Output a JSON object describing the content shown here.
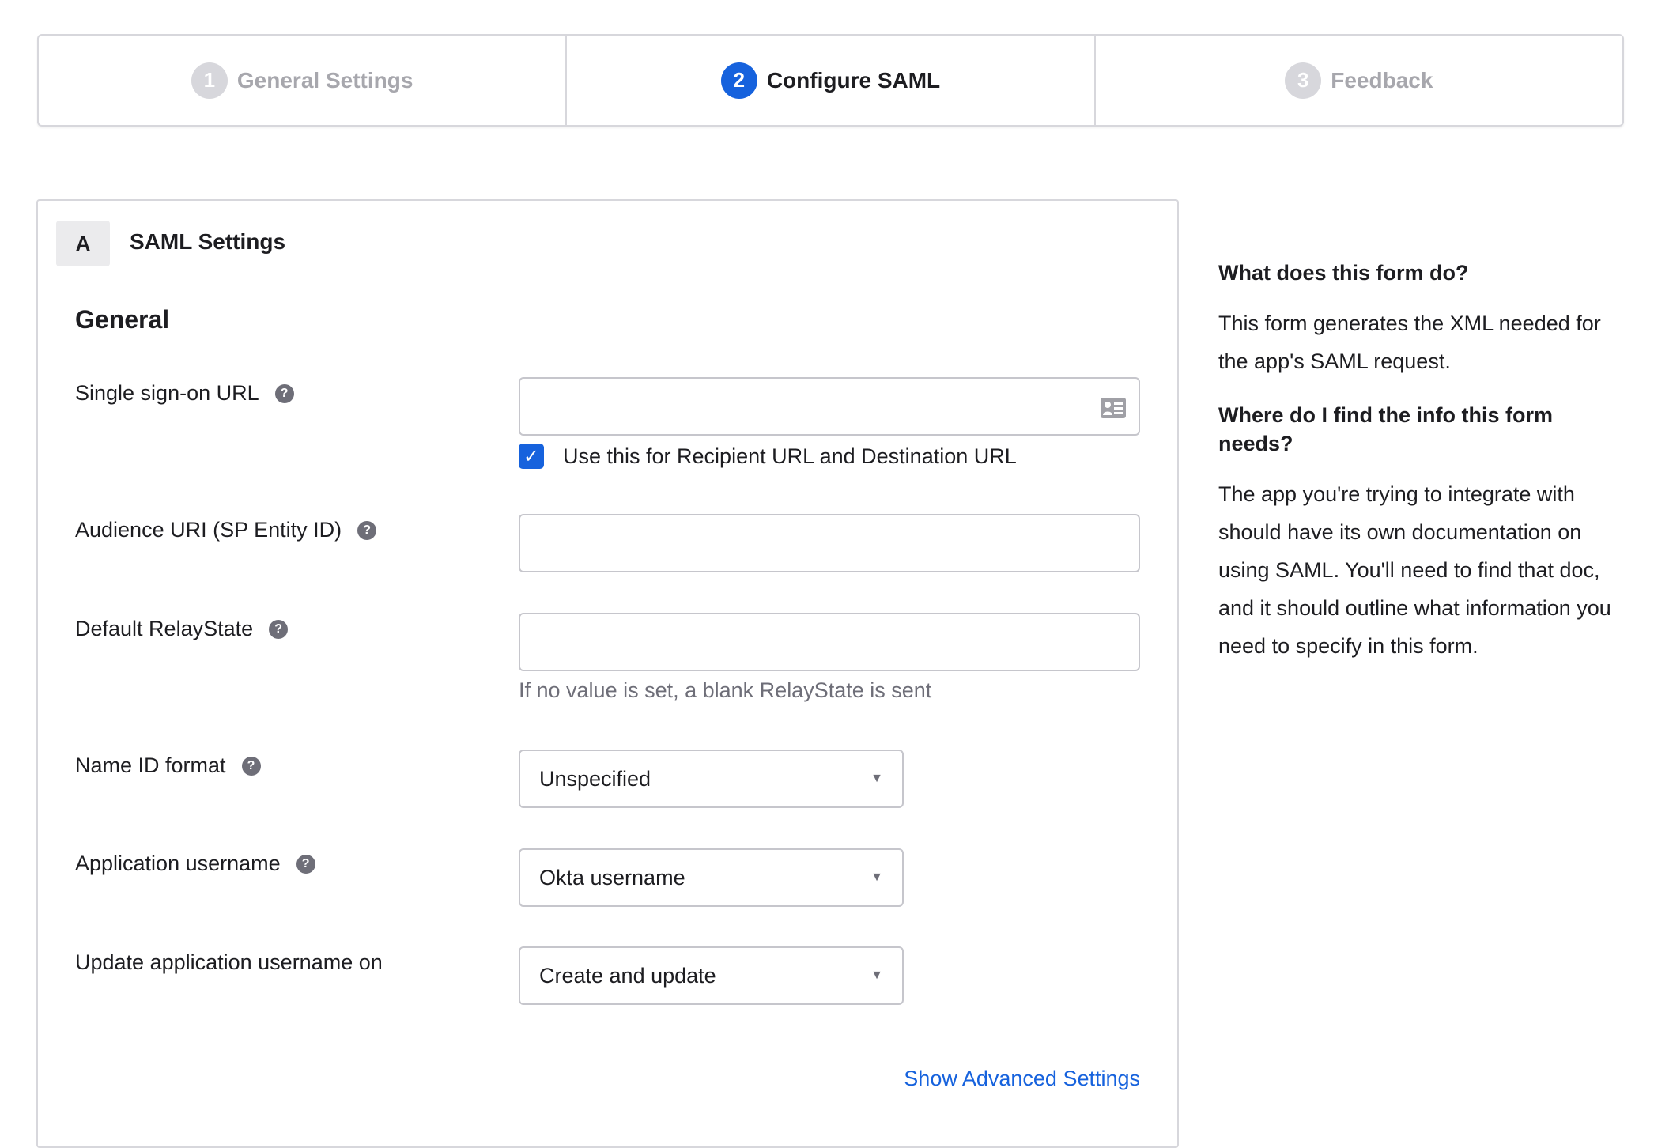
{
  "steps": [
    {
      "num": "1",
      "label": "General Settings",
      "active": false
    },
    {
      "num": "2",
      "label": "Configure SAML",
      "active": true
    },
    {
      "num": "3",
      "label": "Feedback",
      "active": false
    }
  ],
  "section": {
    "letter": "A",
    "title": "SAML Settings",
    "subtitle": "General"
  },
  "fields": {
    "sso_url": {
      "label": "Single sign-on URL",
      "value": "",
      "checkbox_label": "Use this for Recipient URL and Destination URL",
      "checked": true
    },
    "audience": {
      "label": "Audience URI (SP Entity ID)",
      "value": ""
    },
    "relay": {
      "label": "Default RelayState",
      "value": "",
      "hint": "If no value is set, a blank RelayState is sent"
    },
    "name_id": {
      "label": "Name ID format",
      "value": "Unspecified"
    },
    "app_username": {
      "label": "Application username",
      "value": "Okta username"
    },
    "update_on": {
      "label": "Update application username on",
      "value": "Create and update"
    }
  },
  "advanced_link": "Show Advanced Settings",
  "sidebar": {
    "q1": "What does this form do?",
    "a1": "This form generates the XML needed for the app's SAML request.",
    "q2": "Where do I find the info this form needs?",
    "a2": "The app you're trying to integrate with should have its own documentation on using SAML. You'll need to find that doc, and it should outline what information you need to specify in this form."
  },
  "colors": {
    "accent": "#1662dd",
    "border": "#d7d7dc"
  }
}
